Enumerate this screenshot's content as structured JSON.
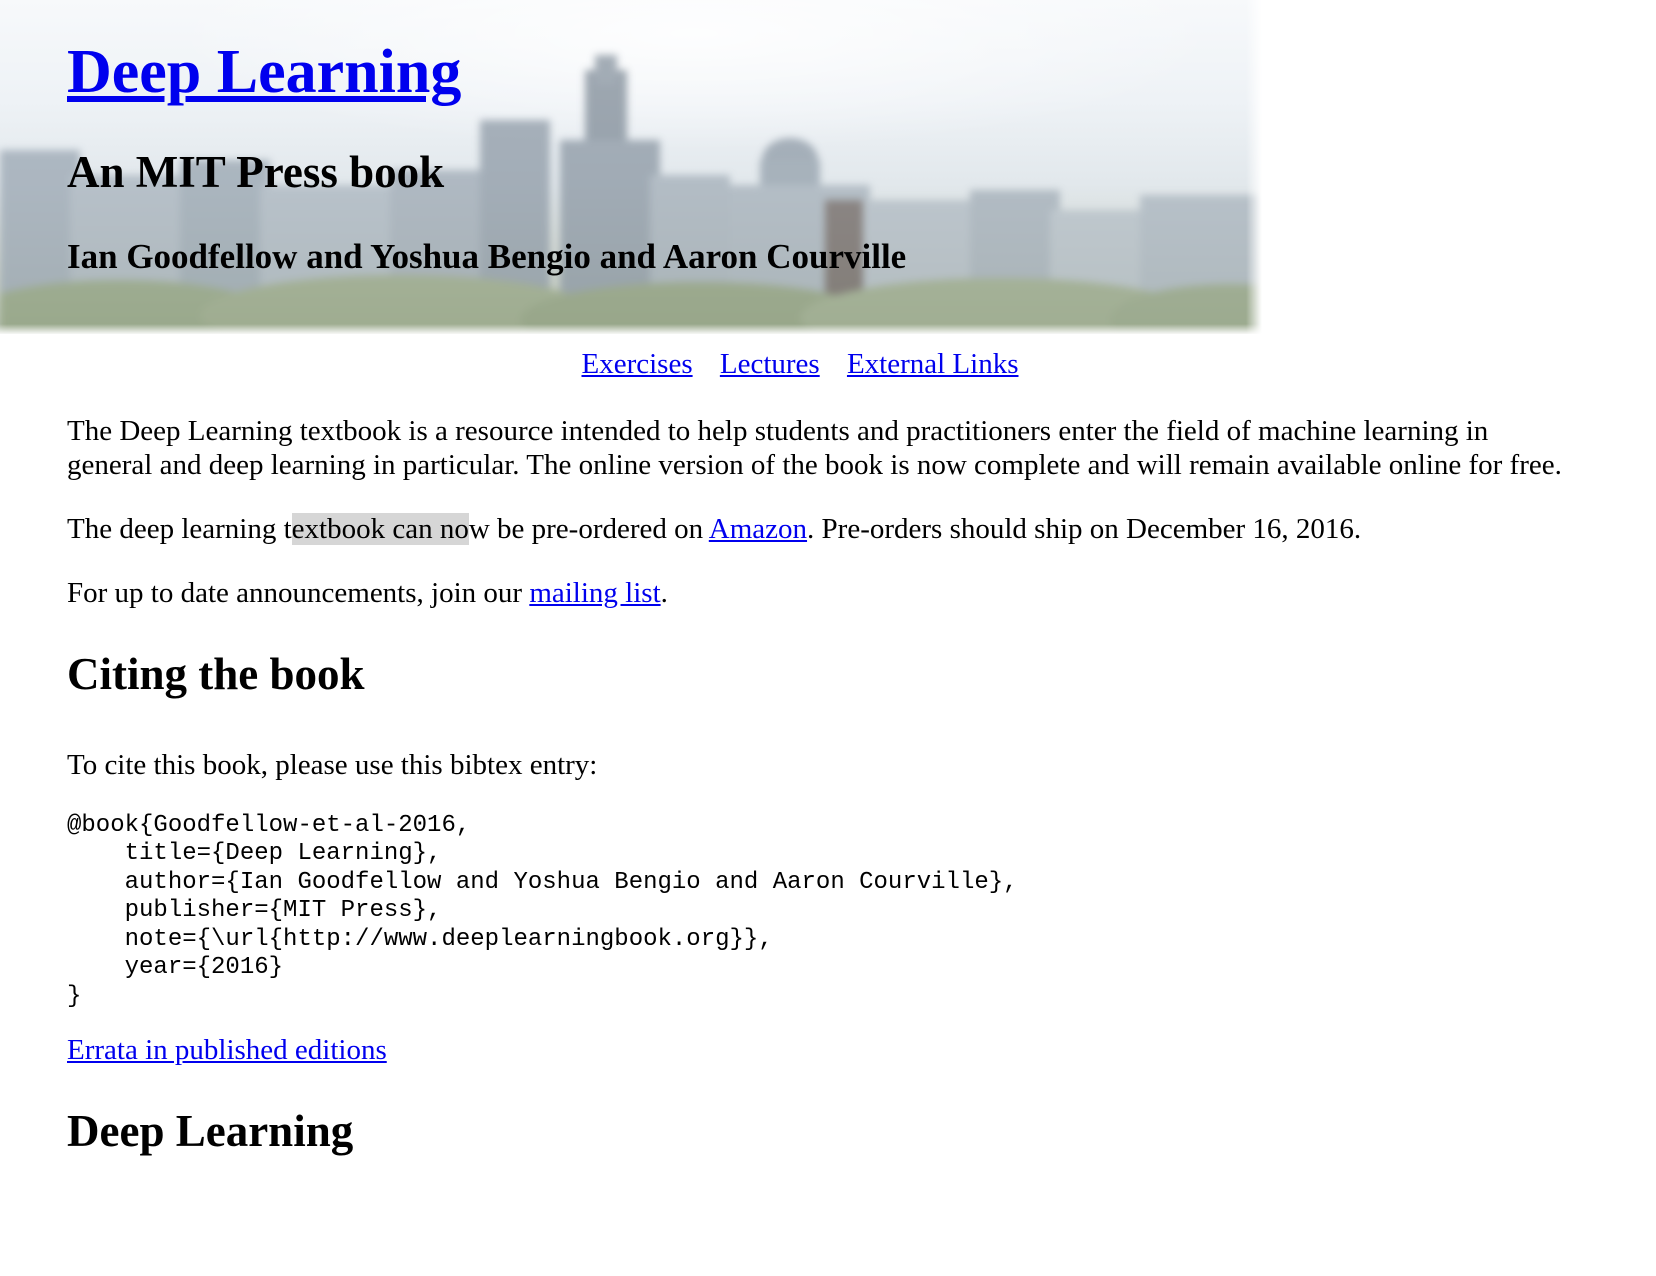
{
  "header": {
    "title": "Deep Learning",
    "subtitle": "An MIT Press book",
    "authors": "Ian Goodfellow and Yoshua Bengio and Aaron Courville"
  },
  "nav": {
    "items": [
      "Exercises",
      "Lectures",
      "External Links"
    ]
  },
  "intro": {
    "paragraph1": "The Deep Learning textbook is a resource intended to help students and practitioners enter the field of machine learning in general and deep learning in particular. The online version of the book is now complete and will remain available online for free.",
    "preorder_before": "The deep learning t",
    "preorder_highlight": "extbook can no",
    "preorder_mid": "w be pre-ordered on ",
    "preorder_link": "Amazon",
    "preorder_after": ". Pre-orders should ship on December 16, 2016.",
    "mailing_before": "For up to date announcements, join our ",
    "mailing_link": "mailing list",
    "mailing_after": "."
  },
  "citing": {
    "heading": "Citing the book",
    "intro": "To cite this book, please use this bibtex entry:",
    "bibtex": "@book{Goodfellow-et-al-2016,\n    title={Deep Learning},\n    author={Ian Goodfellow and Yoshua Bengio and Aaron Courville},\n    publisher={MIT Press},\n    note={\\url{http://www.deeplearningbook.org}},\n    year={2016}\n}",
    "errata_link": "Errata in published editions"
  },
  "next_section": {
    "heading": "Deep Learning"
  },
  "colors": {
    "link": "#0000ee",
    "text": "#000000",
    "selection_highlight": "#d6d6d6"
  }
}
